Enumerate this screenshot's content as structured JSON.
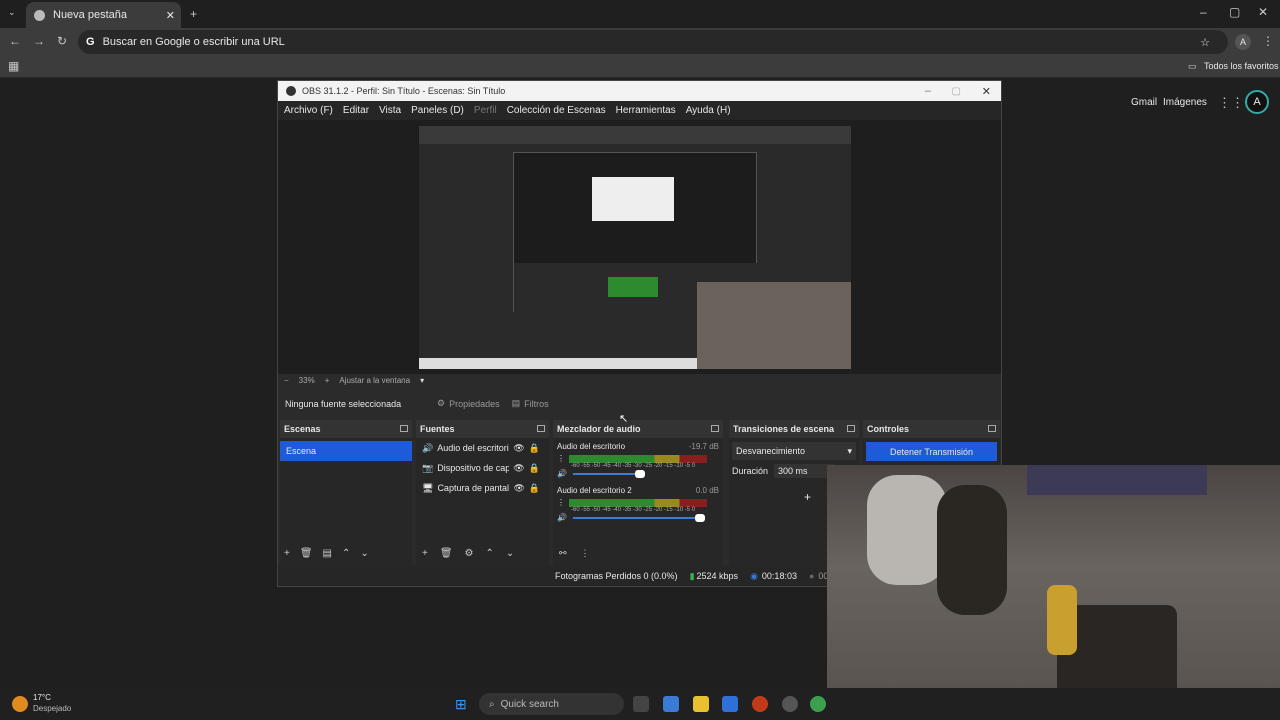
{
  "browser": {
    "tab_title": "Nueva pestaña",
    "omnibox_placeholder": "Buscar en Google o escribir una URL",
    "bookmarks_label": "Todos los favoritos",
    "gmail": "Gmail",
    "images": "Imágenes",
    "profile_initial": "A"
  },
  "obs": {
    "title": "OBS 31.1.2 - Perfil: Sin Título - Escenas: Sin Título",
    "menu": [
      "Archivo (F)",
      "Editar",
      "Vista",
      "Paneles (D)",
      "Perfil",
      "Colección de Escenas",
      "Herramientas",
      "Ayuda (H)"
    ],
    "zoom": "33%",
    "fit_label": "Ajustar a la ventana",
    "no_source": "Ninguna fuente seleccionada",
    "properties": "Propiedades",
    "filters": "Filtros",
    "scenes_title": "Escenas",
    "scene_item": "Escena",
    "sources_title": "Fuentes",
    "sources": [
      "Audio del escritorio",
      "Dispositivo de captura",
      "Captura de pantalla"
    ],
    "mixer_title": "Mezclador de audio",
    "mixer": [
      {
        "name": "Audio del escritorio",
        "db": "-19.7 dB"
      },
      {
        "name": "Audio del escritorio 2",
        "db": "0.0 dB"
      }
    ],
    "meter_scale": "-60 -55 -50 -45 -40 -35 -30 -25 -20 -15 -10 -5 0",
    "transitions_title": "Transiciones de escena",
    "transition": "Desvanecimiento",
    "duration_label": "Duración",
    "duration_value": "300 ms",
    "controls_title": "Controles",
    "stop_button": "Detener Transmisión",
    "dropped": "Fotogramas Perdidos 0 (0.0%)",
    "bitrate": "2524 kbps",
    "time": "00:18:03",
    "time2": "00"
  },
  "taskbar": {
    "temp": "17°C",
    "weather": "Despejado",
    "search": "Quick search"
  }
}
